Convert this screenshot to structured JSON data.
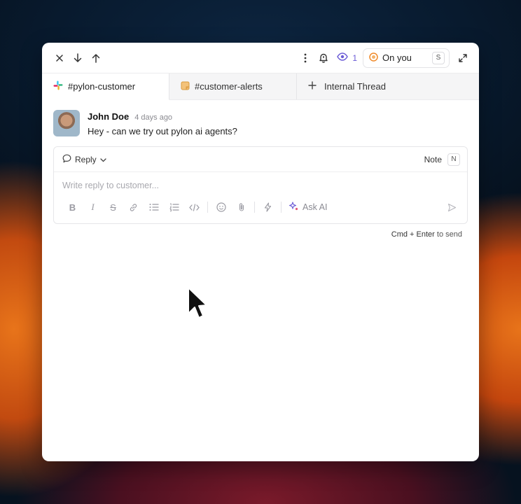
{
  "toolbar": {
    "close_icon": "close-icon",
    "down_icon": "arrow-down-icon",
    "up_icon": "arrow-up-icon",
    "more_icon": "more-vertical-icon",
    "bell_icon": "bell-icon",
    "viewers_count": "1",
    "assignee_label": "On you",
    "assignee_shortcut": "S",
    "expand_icon": "expand-icon"
  },
  "tabs": [
    {
      "label": "#pylon-customer",
      "icon": "slack-icon",
      "active": true
    },
    {
      "label": "#customer-alerts",
      "icon": "note-icon",
      "active": false
    },
    {
      "label": "Internal Thread",
      "icon": "plus-icon",
      "active": false
    }
  ],
  "message": {
    "author": "John Doe",
    "time": "4 days ago",
    "body": "Hey - can we try out pylon ai agents?"
  },
  "composer": {
    "mode_label": "Reply",
    "note_label": "Note",
    "note_shortcut": "N",
    "placeholder": "Write reply to customer...",
    "ask_ai_label": "Ask AI"
  },
  "hint": {
    "keys": "Cmd + Enter",
    "suffix": "to send"
  },
  "colors": {
    "accent": "#6b5bd6",
    "assignee_ring": "#f08a2a",
    "note_tab_icon": "#e9a23b"
  }
}
